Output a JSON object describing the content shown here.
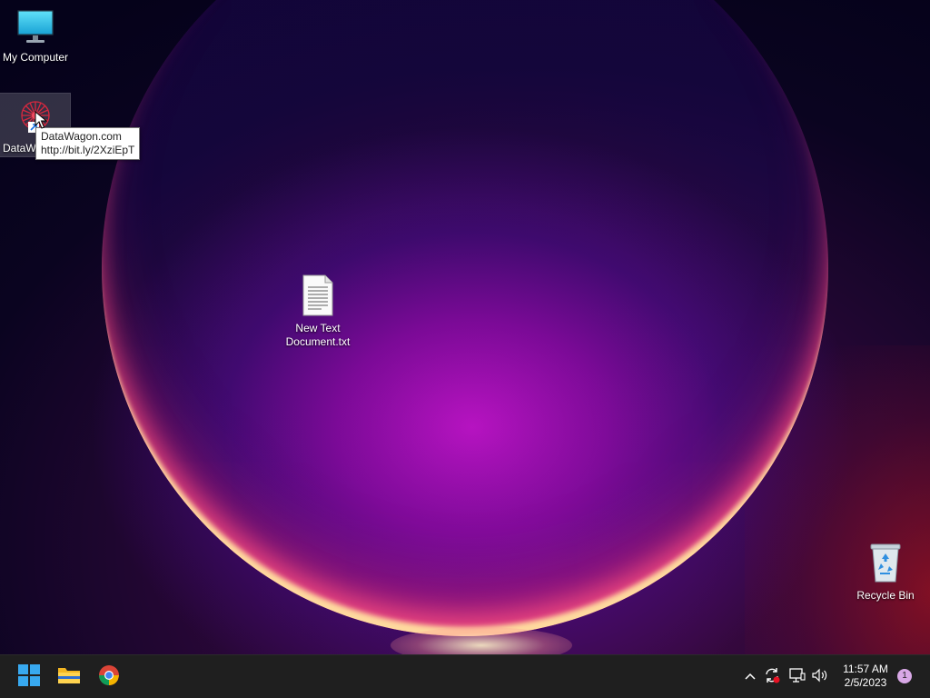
{
  "desktop": {
    "icons": [
      {
        "label": "My Computer",
        "icon": "monitor-icon"
      },
      {
        "label": "DataW",
        "icon": "datawagon-icon"
      },
      {
        "label": "New Text Document.txt",
        "icon": "text-file-icon"
      },
      {
        "label": "Recycle Bin",
        "icon": "recycle-bin-icon"
      }
    ],
    "tooltip": {
      "line1": "DataWagon.com",
      "line2": "http://bit.ly/2XziEpT"
    }
  },
  "taskbar": {
    "apps": [
      {
        "name": "start",
        "icon": "windows-start-icon"
      },
      {
        "name": "file-explorer",
        "icon": "folder-icon"
      },
      {
        "name": "chrome",
        "icon": "chrome-icon"
      }
    ],
    "tray": {
      "icons": [
        "chevron-up-icon",
        "sync-icon",
        "network-icon",
        "volume-icon"
      ]
    },
    "clock": {
      "time": "11:57 AM",
      "date": "2/5/2023"
    },
    "notification_count": "1"
  },
  "colors": {
    "taskbar_bg": "#1f1f1f",
    "accent": "#0078d4"
  }
}
